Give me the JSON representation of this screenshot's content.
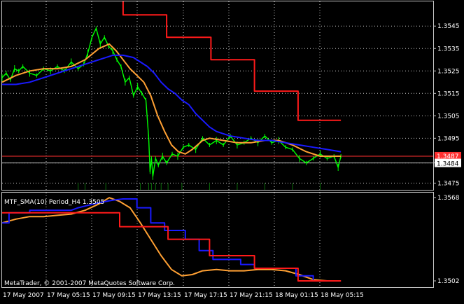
{
  "indicator_label": "MTF_SMA(10) Period_H4 1.3505",
  "copyright": "MetaTrader, © 2001-2007 MetaQuotes Software Corp.",
  "colors": {
    "background": "#000000",
    "grid": "#c8c8c8",
    "price": "#00ff00",
    "sma_fast": "#ffa033",
    "sma_slow": "#1a1aff",
    "sma_h4": "#ff1a1a",
    "last_price_line": "#c0c0c0",
    "marker_line": "#ff3030"
  },
  "chart_data": [
    {
      "type": "line",
      "panel": "main",
      "ylim": [
        1.3472,
        1.3556
      ],
      "y_ticks": [
        "1.3545",
        "1.3535",
        "1.3525",
        "1.3515",
        "1.3505",
        "1.3495",
        "1.3484",
        "1.3475"
      ],
      "last_price": 1.3484,
      "last_price_label": "1.3484",
      "marker_price": 1.3487,
      "marker_label": "1.3487",
      "x_labels": [
        "17 May 2007",
        "17 May 05:15",
        "17 May 09:15",
        "17 May 13:15",
        "17 May 17:15",
        "17 May 21:15",
        "18 May 01:15",
        "18 May 05:15"
      ],
      "series": [
        {
          "key": "price",
          "x": [
            0,
            6,
            12,
            18,
            24,
            30,
            40,
            50,
            60,
            70,
            80,
            90,
            100,
            110,
            118,
            124,
            130,
            136,
            142,
            148,
            154,
            160,
            166,
            172,
            178,
            184,
            190,
            196,
            202,
            208,
            212,
            214,
            216,
            218,
            222,
            226,
            232,
            238,
            246,
            254,
            262,
            270,
            280,
            290,
            300,
            310,
            320,
            330,
            340,
            350,
            360,
            370,
            380,
            390,
            400,
            410,
            420,
            430,
            440,
            450,
            460,
            470,
            480,
            486,
            490
          ],
          "y": [
            1.3522,
            1.3524,
            1.3521,
            1.3526,
            1.3525,
            1.3527,
            1.3524,
            1.3523,
            1.3526,
            1.3525,
            1.3527,
            1.3525,
            1.3529,
            1.3526,
            1.3528,
            1.3533,
            1.354,
            1.3544,
            1.3537,
            1.354,
            1.3536,
            1.3534,
            1.353,
            1.3527,
            1.352,
            1.3522,
            1.3514,
            1.3518,
            1.3515,
            1.3512,
            1.3495,
            1.348,
            1.3486,
            1.3478,
            1.3486,
            1.3483,
            1.3487,
            1.3484,
            1.3488,
            1.3487,
            1.3491,
            1.3492,
            1.349,
            1.3495,
            1.3492,
            1.3494,
            1.3492,
            1.3496,
            1.3492,
            1.3493,
            1.3495,
            1.3493,
            1.3496,
            1.3493,
            1.3494,
            1.3491,
            1.349,
            1.3486,
            1.3484,
            1.3486,
            1.3488,
            1.3486,
            1.3487,
            1.3482,
            1.3487
          ]
        },
        {
          "key": "sma_fast",
          "x": [
            0,
            20,
            40,
            60,
            80,
            100,
            120,
            140,
            155,
            165,
            175,
            185,
            195,
            205,
            215,
            225,
            235,
            245,
            255,
            265,
            275,
            290,
            300,
            320,
            340,
            360,
            380,
            400,
            420,
            440,
            460,
            475,
            490
          ],
          "y": [
            1.352,
            1.3523,
            1.3525,
            1.3526,
            1.3526,
            1.3527,
            1.353,
            1.3535,
            1.3537,
            1.3534,
            1.353,
            1.3526,
            1.3523,
            1.352,
            1.3514,
            1.3505,
            1.3498,
            1.3492,
            1.3489,
            1.3488,
            1.349,
            1.3494,
            1.3495,
            1.3494,
            1.3493,
            1.3493,
            1.3494,
            1.3494,
            1.3492,
            1.3489,
            1.3487,
            1.3487,
            1.3487
          ]
        },
        {
          "key": "sma_slow",
          "x": [
            0,
            20,
            40,
            60,
            80,
            100,
            120,
            140,
            160,
            175,
            190,
            200,
            210,
            220,
            230,
            240,
            250,
            260,
            270,
            280,
            290,
            300,
            310,
            320,
            330,
            350,
            370,
            390,
            410,
            430,
            450,
            470,
            490
          ],
          "y": [
            1.3519,
            1.3519,
            1.352,
            1.3522,
            1.3524,
            1.3526,
            1.3528,
            1.353,
            1.3532,
            1.3532,
            1.3531,
            1.3529,
            1.3527,
            1.3524,
            1.352,
            1.3517,
            1.3515,
            1.3512,
            1.351,
            1.3506,
            1.3503,
            1.35,
            1.3498,
            1.3497,
            1.3496,
            1.3495,
            1.3494,
            1.3494,
            1.3493,
            1.3492,
            1.3491,
            1.349,
            1.3489
          ]
        },
        {
          "key": "sma_h4",
          "x": [
            175,
            175,
            238,
            238,
            302,
            302,
            365,
            365,
            428,
            428,
            490
          ],
          "y": [
            1.3556,
            1.355,
            1.355,
            1.354,
            1.354,
            1.353,
            1.353,
            1.3516,
            1.3516,
            1.3503,
            1.3503
          ]
        }
      ]
    },
    {
      "type": "line",
      "panel": "indicator",
      "ylim": [
        1.3497,
        1.3572
      ],
      "y_ticks": [
        "1.3568",
        "1.3502"
      ],
      "series": [
        {
          "key": "sma_fast",
          "x": [
            0,
            20,
            40,
            60,
            80,
            100,
            120,
            140,
            155,
            170,
            185,
            200,
            215,
            230,
            245,
            260,
            275,
            290,
            310,
            330,
            350,
            370,
            390,
            410,
            430,
            450,
            470,
            490
          ],
          "y": [
            1.3548,
            1.3551,
            1.3553,
            1.3553,
            1.3554,
            1.3555,
            1.3558,
            1.3563,
            1.3568,
            1.3565,
            1.356,
            1.3548,
            1.3535,
            1.3522,
            1.3511,
            1.3506,
            1.3507,
            1.351,
            1.3511,
            1.351,
            1.351,
            1.3511,
            1.3511,
            1.351,
            1.3507,
            1.3503,
            1.3502,
            1.3502
          ]
        },
        {
          "key": "sma_slow",
          "x": [
            0,
            10,
            10,
            40,
            40,
            100,
            110,
            140,
            160,
            175,
            195,
            195,
            215,
            215,
            235,
            235,
            265,
            265,
            285,
            285,
            305,
            305,
            345,
            345,
            365,
            365,
            425,
            425,
            450,
            450,
            490
          ],
          "y": [
            1.3548,
            1.3548,
            1.3556,
            1.3556,
            1.3558,
            1.3558,
            1.356,
            1.3564,
            1.3566,
            1.3567,
            1.3567,
            1.356,
            1.356,
            1.3548,
            1.3548,
            1.3542,
            1.3542,
            1.3535,
            1.3535,
            1.3526,
            1.3526,
            1.3519,
            1.3519,
            1.3515,
            1.3515,
            1.3512,
            1.3512,
            1.3506,
            1.3506,
            1.3502,
            1.3502
          ]
        },
        {
          "key": "sma_h4",
          "x": [
            0,
            105,
            105,
            170,
            170,
            240,
            240,
            300,
            300,
            365,
            365,
            428,
            428,
            490
          ],
          "y": [
            1.3556,
            1.3556,
            1.3556,
            1.3556,
            1.3545,
            1.3545,
            1.3535,
            1.3535,
            1.3522,
            1.3522,
            1.3512,
            1.3512,
            1.3502,
            1.3502
          ]
        }
      ]
    }
  ]
}
